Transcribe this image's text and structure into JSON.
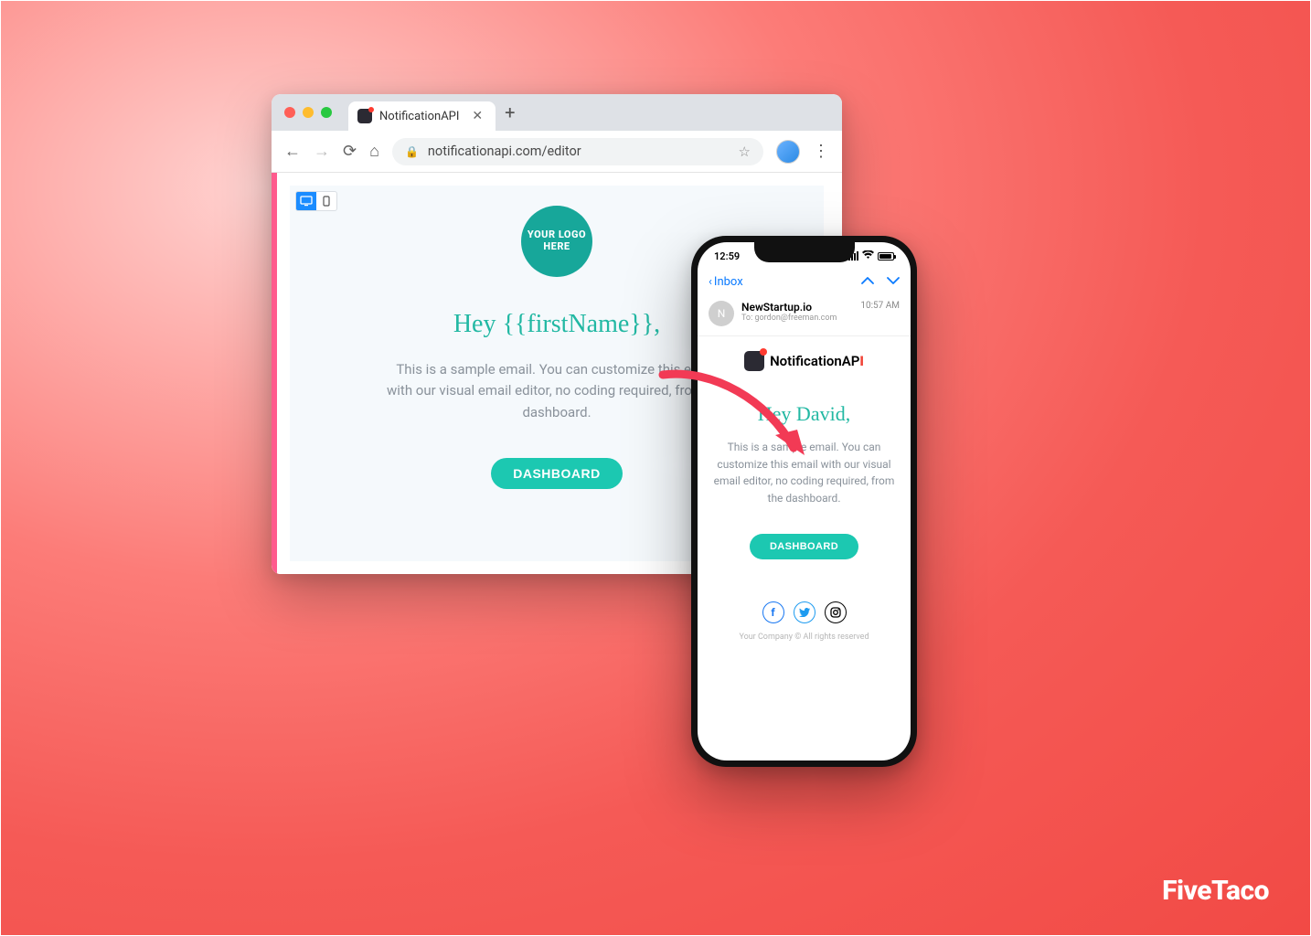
{
  "browser": {
    "tab_title": "NotificationAPI",
    "url": "notificationapi.com/editor",
    "logo_text": "YOUR LOGO HERE",
    "heading": "Hey {{firstName}},",
    "body": "This is a sample email. You can customize this email with our visual email editor, no coding required, from the dashboard.",
    "cta": "DASHBOARD"
  },
  "phone": {
    "time": "12:59",
    "back_label": "Inbox",
    "sender": "NewStartup.io",
    "to_line": "To:  gordon@freeman.com",
    "received_time": "10:57 AM",
    "brand_name_plain": "NotificationAP",
    "brand_name_accent": "I",
    "heading": "Hey David,",
    "body": "This is a sample email. You can customize this email with our visual email editor, no coding required, from the dashboard.",
    "cta": "DASHBOARD",
    "footer": "Your Company © All rights reserved",
    "sender_initial": "N"
  },
  "watermark": "FiveTaco"
}
